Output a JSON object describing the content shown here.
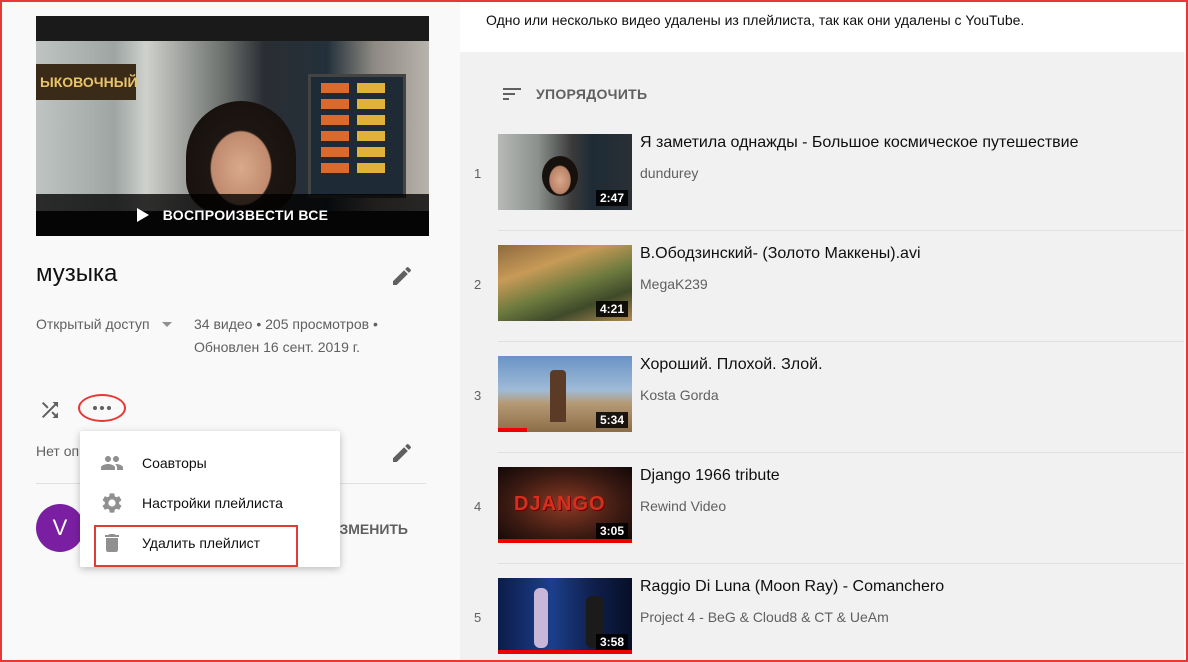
{
  "playlist": {
    "play_all": "ВОСПРОИЗВЕСТИ ВСЕ",
    "thumb_sign": "ЫКОВОЧНЫЙ",
    "title": "музыка",
    "privacy": "Открытый доступ",
    "stats": "34 видео • 205 просмотров • Обновлен 16 сент. 2019 г.",
    "description": "Нет описания",
    "owner_initial": "V",
    "change_label": "ИЗМЕНИТЬ"
  },
  "menu": {
    "items": [
      {
        "label": "Соавторы",
        "icon": "people-icon"
      },
      {
        "label": "Настройки плейлиста",
        "icon": "gear-icon"
      },
      {
        "label": "Удалить плейлист",
        "icon": "trash-icon"
      }
    ]
  },
  "notice": "Одно или несколько видео удалены из плейлиста, так как они удалены с YouTube.",
  "sort_label": "УПОРЯДОЧИТЬ",
  "videos": [
    {
      "index": "1",
      "title": "Я заметила однажды - Большое космическое путешествие",
      "channel": "dundurey",
      "duration": "2:47",
      "progress": 0
    },
    {
      "index": "2",
      "title": "В.Ободзинский- (Золото Маккены).avi",
      "channel": "MegaK239",
      "duration": "4:21",
      "progress": 0
    },
    {
      "index": "3",
      "title": "Хороший. Плохой. Злой.",
      "channel": "Kosta Gorda",
      "duration": "5:34",
      "progress": 0.22
    },
    {
      "index": "4",
      "title": "Django 1966 tribute",
      "channel": "Rewind Video",
      "duration": "3:05",
      "progress": 1.0,
      "logo": "DJANGO"
    },
    {
      "index": "5",
      "title": "Raggio Di Luna (Moon Ray) - Comanchero",
      "channel": "Project 4 - BeG & Cloud8 & CT & UeAm",
      "duration": "3:58",
      "progress": 1.0
    }
  ],
  "colors": {
    "accent_red": "#e53935",
    "progress_red": "#ee0000",
    "avatar_purple": "#7b1fa2"
  }
}
